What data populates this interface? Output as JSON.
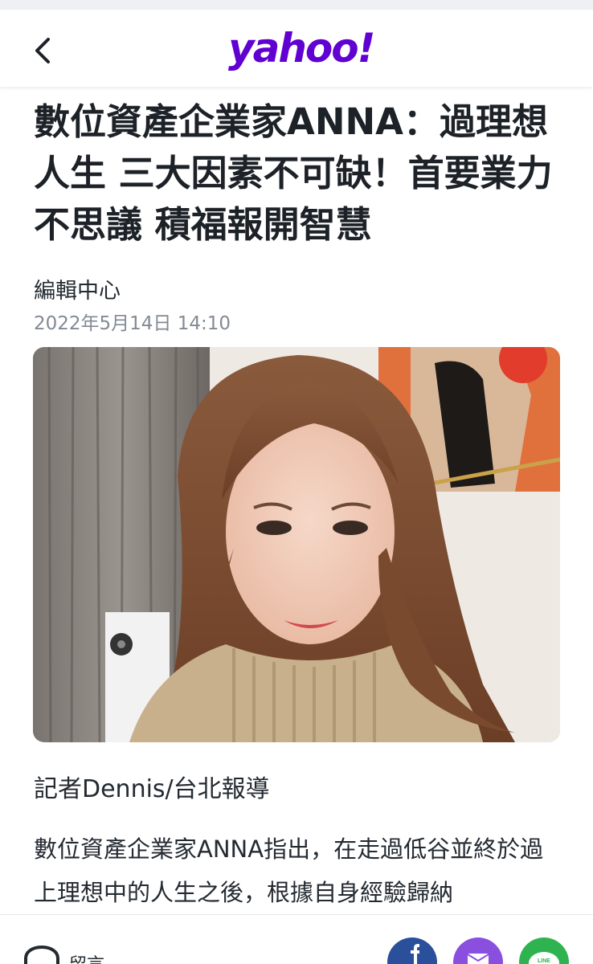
{
  "header": {
    "logo_text": "yahoo!",
    "brand_color": "#6001d2"
  },
  "article": {
    "title": "數位資產企業家ANNA：過理想人生 三大因素不可缺！首要業力不思議 積福報開智慧",
    "author": "編輯中心",
    "date": "2022年5月14日 14:10",
    "byline": "記者Dennis/台北報導",
    "body": "數位資產企業家ANNA指出，在走過低谷並終於過上理想中的人生之後，根據自身經驗歸納"
  },
  "footer": {
    "comment_label": "留言",
    "share_icons": [
      "facebook-icon",
      "mail-icon",
      "line-icon"
    ],
    "line_text": "LINE"
  }
}
